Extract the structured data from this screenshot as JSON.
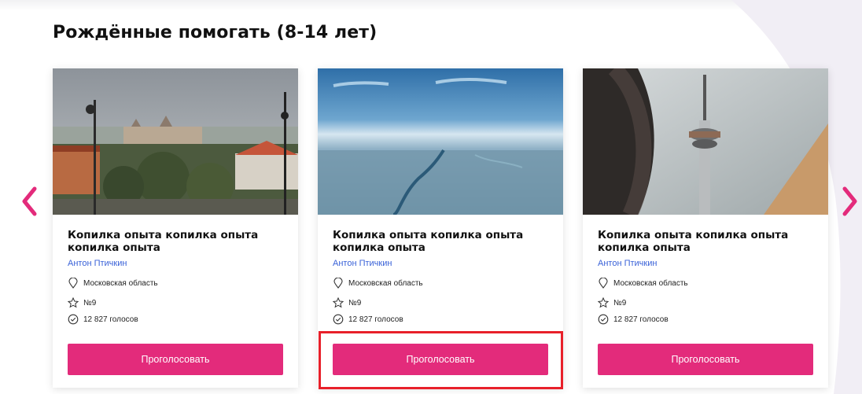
{
  "section": {
    "title": "Рождённые помогать (8-14 лет)"
  },
  "colors": {
    "accent": "#e32b7b",
    "link": "#3a62d8",
    "highlight": "#e8202a"
  },
  "navigation": {
    "prev_icon": "chevron-left-icon",
    "next_icon": "chevron-right-icon"
  },
  "cards": [
    {
      "image": "budapest-parliament-photo",
      "title": "Копилка опыта копилка опыта копилка опыта",
      "author": "Антон Птичкин",
      "location": "Московская область",
      "number": "№9",
      "votes": "12 827 голосов",
      "button": "Проголосовать"
    },
    {
      "image": "aerial-river-photo",
      "title": "Копилка опыта копилка опыта копилка опыта",
      "author": "Антон Птичкин",
      "location": "Московская область",
      "number": "№9",
      "votes": "12 827 голосов",
      "button": "Проголосовать"
    },
    {
      "image": "tv-tower-photo",
      "title": "Копилка опыта копилка опыта копилка опыта",
      "author": "Антон Птичкин",
      "location": "Московская область",
      "number": "№9",
      "votes": "12 827 голосов",
      "button": "Проголосовать"
    }
  ]
}
